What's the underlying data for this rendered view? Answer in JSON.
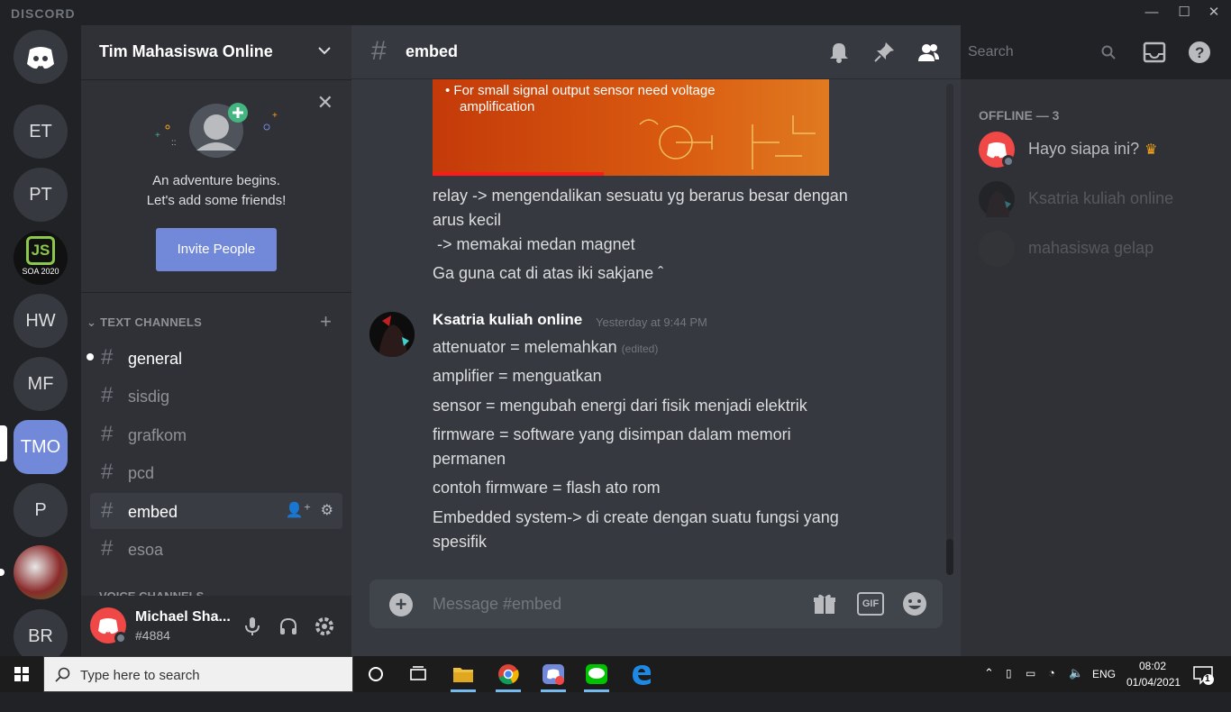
{
  "titlebar": {
    "brand": "DISCORD"
  },
  "guilds": [
    {
      "label": "ET"
    },
    {
      "label": "PT"
    },
    {
      "label": "JS",
      "sub": "SOA 2020"
    },
    {
      "label": "HW"
    },
    {
      "label": "MF"
    },
    {
      "label": "TMO",
      "active": true
    },
    {
      "label": "P"
    },
    {
      "label": ""
    },
    {
      "label": "BR"
    }
  ],
  "server": {
    "name": "Tim Mahasiswa Online",
    "friends_line1": "An adventure begins.",
    "friends_line2": "Let's add some friends!",
    "invite_label": "Invite People",
    "text_category": "TEXT CHANNELS",
    "voice_category": "VOICE CHANNELS",
    "channels": [
      {
        "name": "general"
      },
      {
        "name": "sisdig"
      },
      {
        "name": "grafkom"
      },
      {
        "name": "pcd"
      },
      {
        "name": "embed"
      },
      {
        "name": "esoa"
      }
    ]
  },
  "user": {
    "name": "Michael Sha...",
    "tag": "#4884"
  },
  "channel": {
    "title": "embed"
  },
  "search": {
    "placeholder": "Search"
  },
  "messages": {
    "embed_text_line1": "• For small signal output sensor need voltage",
    "embed_text_line2": "amplification",
    "prev_lines": [
      "relay -> mengendalikan sesuatu yg berarus besar dengan",
      "arus kecil",
      " -> memakai medan magnet",
      "Ga guna cat di atas iki sakjane ˆ"
    ],
    "author": "Ksatria kuliah online",
    "timestamp": "Yesterday at 9:44 PM",
    "lines": [
      "attenuator = melemahkan",
      "amplifier = menguatkan",
      "sensor = mengubah energi dari fisik menjadi elektrik",
      "firmware = software yang disimpan dalam memori",
      "permanen",
      "contoh firmware = flash ato rom",
      "Embedded system-> di create dengan suatu fungsi yang",
      "spesifik"
    ],
    "edited": "(edited)"
  },
  "composer": {
    "placeholder": "Message #embed",
    "gif": "GIF"
  },
  "members": {
    "category": "OFFLINE — 3",
    "list": [
      {
        "name": "Hayo siapa ini?"
      },
      {
        "name": "Ksatria kuliah online"
      },
      {
        "name": "mahasiswa gelap"
      }
    ]
  },
  "taskbar": {
    "search_placeholder": "Type here to search",
    "lang": "ENG",
    "time": "08:02",
    "date": "01/04/2021",
    "notif_count": "1"
  },
  "colors": {
    "blurple": "#7289da",
    "bg_main": "#36393f",
    "bg_side": "#2f3136",
    "bg_dark": "#202225"
  }
}
